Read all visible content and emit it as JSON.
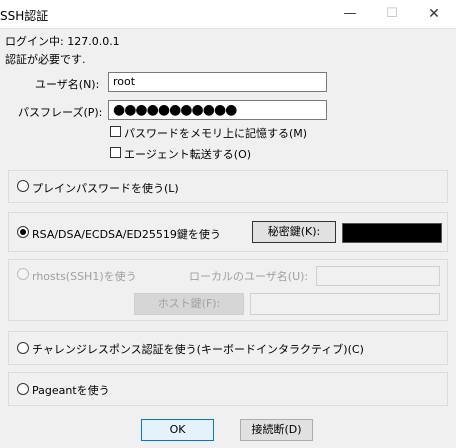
{
  "window": {
    "title": "SSH認証",
    "minimize": "—",
    "maximize": "☐",
    "close": "✕"
  },
  "info": {
    "login_line": "ログイン中: 127.0.0.1",
    "auth_required": "認証が必要です."
  },
  "form": {
    "username_label": "ユーザ名(N):",
    "username_value": "root",
    "passphrase_label": "パスフレーズ(P):",
    "passphrase_value": "●●●●●●●●●●●",
    "remember_password": "パスワードをメモリ上に記憶する(M)",
    "agent_forwarding": "エージェント転送する(O)"
  },
  "methods": {
    "plain_password": "プレインパスワードを使う(L)",
    "rsa_key": "RSA/DSA/ECDSA/ED25519鍵を使う",
    "secret_key_button": "秘密鍵(K):",
    "rhosts": "rhosts(SSH1)を使う",
    "local_user_label": "ローカルのユーザ名(U):",
    "host_key_button": "ホスト鍵(F):",
    "challenge_response": "チャレンジレスポンス認証を使う(キーボードインタラクティブ)(C)",
    "pageant": "Pageantを使う"
  },
  "buttons": {
    "ok": "OK",
    "disconnect": "接続断(D)"
  }
}
